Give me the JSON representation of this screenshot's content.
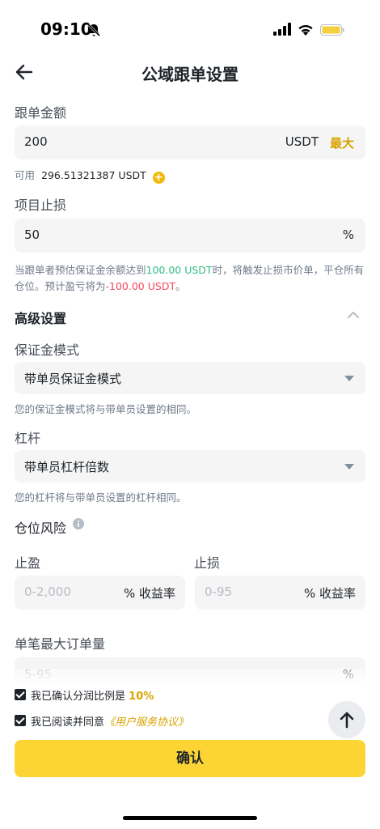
{
  "status": {
    "time": "09:10"
  },
  "header": {
    "title": "公域跟单设置"
  },
  "amount": {
    "label": "跟单金额",
    "value": "200",
    "unit": "USDT",
    "max_label": "最大",
    "available_prefix": "可用",
    "available_value": "296.51321387 USDT"
  },
  "stop_loss": {
    "label": "项目止损",
    "value": "50",
    "unit": "%",
    "note_part1": "当跟单者预估保证金余额达到",
    "note_highlight1": "100.00 USDT",
    "note_part2": "时，将触发止损市价单，平仓所有仓位。预计盈亏将为",
    "note_highlight2": "-100.00 USDT",
    "note_part3": "。"
  },
  "advanced": {
    "label": "高级设置",
    "margin_mode_label": "保证金模式",
    "margin_mode_value": "带单员保证金模式",
    "margin_mode_note": "您的保证金模式将与带单员设置的相同。",
    "leverage_label": "杠杆",
    "leverage_value": "带单员杠杆倍数",
    "leverage_note": "您的杠杆将与带单员设置的杠杆相同。",
    "risk_label": "仓位风险",
    "tp_label": "止盈",
    "tp_placeholder": "0-2,000",
    "tp_unit": "% 收益率",
    "sl_label": "止损",
    "sl_placeholder": "0-95",
    "sl_unit": "% 收益率",
    "max_order_label": "单笔最大订单量",
    "max_order_placeholder": "5-95",
    "max_order_unit": "%"
  },
  "agreements": {
    "ratio_text": "我已确认分润比例是",
    "ratio_value": "10%",
    "terms_text": "我已阅读并同意",
    "terms_link": "《用户服务协议》"
  },
  "confirm_label": "确认",
  "colors": {
    "accent": "#fcd535",
    "gold_text": "#d9a300",
    "green": "#2ebd85",
    "red": "#f6465d"
  }
}
